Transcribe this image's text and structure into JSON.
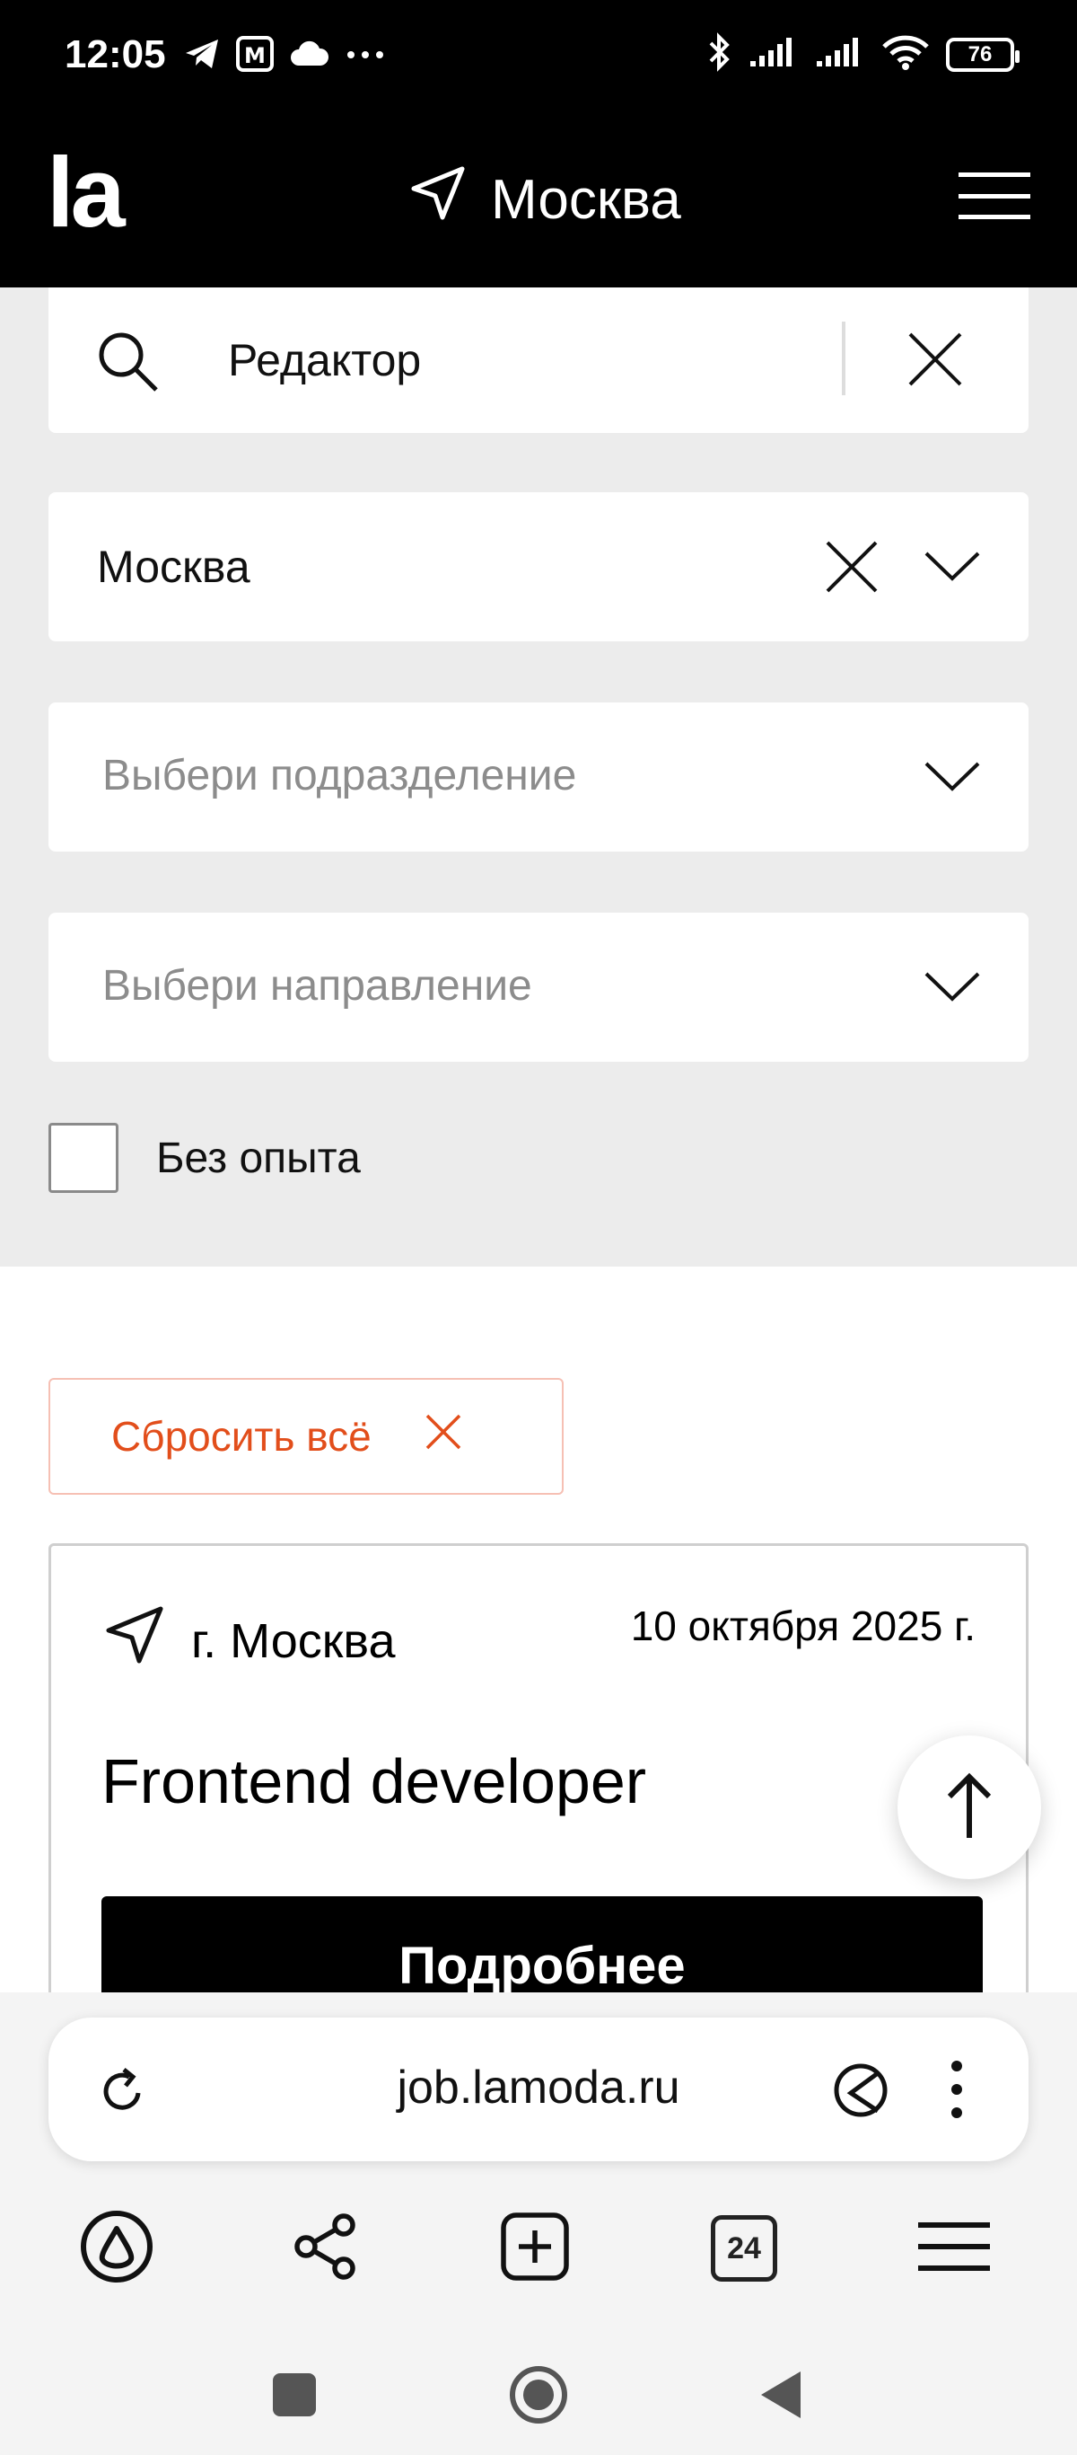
{
  "status_bar": {
    "time": "12:05",
    "icons_left": [
      "telegram-icon",
      "metro-icon",
      "cloud-icon",
      "more-dots-icon"
    ],
    "icons_right": [
      "bluetooth-icon",
      "signal-icon",
      "signal-icon",
      "wifi-icon"
    ],
    "battery": "76"
  },
  "header": {
    "logo": "la",
    "city": "Москва"
  },
  "filters": {
    "search_value": "Редактор",
    "city_value": "Москва",
    "department_placeholder": "Выбери подразделение",
    "direction_placeholder": "Выбери направление",
    "no_experience_label": "Без опыта",
    "no_experience_checked": false
  },
  "reset_label": "Сбросить всё",
  "vacancy": {
    "city": "г. Москва",
    "date": "10 октября 2025 г.",
    "title": "Frontend developer",
    "button": "Подробнее"
  },
  "browser": {
    "url": "job.lamoda.ru",
    "tabs_count": "24"
  },
  "colors": {
    "accent": "#e24e1b",
    "header_bg": "#000000",
    "filters_bg": "#ececec"
  }
}
